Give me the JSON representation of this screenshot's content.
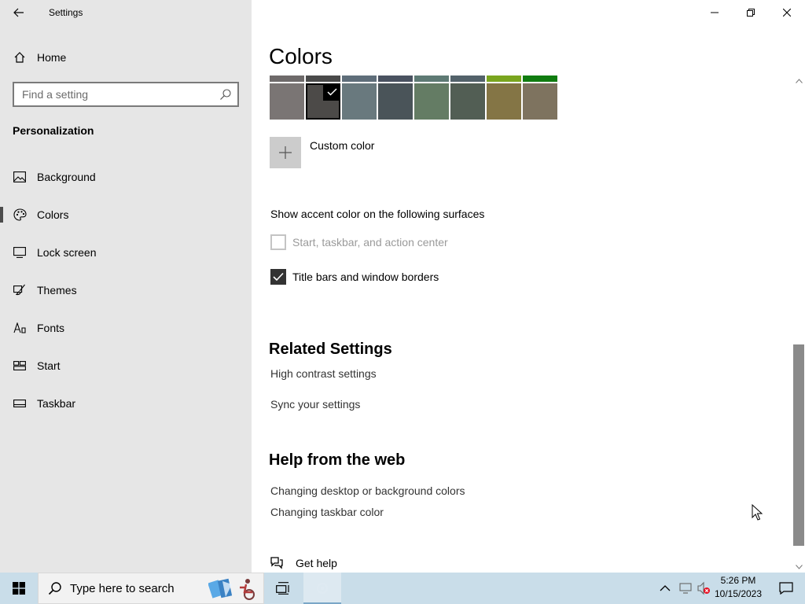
{
  "window": {
    "title": "Settings"
  },
  "sidebar": {
    "home_label": "Home",
    "search_placeholder": "Find a setting",
    "section_title": "Personalization",
    "items": [
      {
        "label": "Background",
        "icon": "image-icon",
        "active": false
      },
      {
        "label": "Colors",
        "icon": "palette-icon",
        "active": true
      },
      {
        "label": "Lock screen",
        "icon": "lock-screen-icon",
        "active": false
      },
      {
        "label": "Themes",
        "icon": "brush-icon",
        "active": false
      },
      {
        "label": "Fonts",
        "icon": "fonts-icon",
        "active": false
      },
      {
        "label": "Start",
        "icon": "start-icon",
        "active": false
      },
      {
        "label": "Taskbar",
        "icon": "taskbar-icon",
        "active": false
      }
    ]
  },
  "main": {
    "page_title": "Colors",
    "swatch_top_colors": [
      "#6e6a6a",
      "#4a4a4a",
      "#5f6e7a",
      "#4a5260",
      "#5e7a74",
      "#53626a",
      "#7aa51e",
      "#107c10"
    ],
    "swatch_colors": [
      "#7a7574",
      "#4c4a48",
      "#69797e",
      "#4a5459",
      "#647c64",
      "#525e54",
      "#847545",
      "#7e735f"
    ],
    "selected_swatch_index": 1,
    "custom_color_label": "Custom color",
    "surfaces_title": "Show accent color on the following surfaces",
    "checkbox_start": {
      "label": "Start, taskbar, and action center",
      "checked": false,
      "disabled": true
    },
    "checkbox_titlebars": {
      "label": "Title bars and window borders",
      "checked": true,
      "disabled": false
    },
    "related_title": "Related Settings",
    "related_links": [
      "High contrast settings",
      "Sync your settings"
    ],
    "help_title": "Help from the web",
    "help_links": [
      "Changing desktop or background colors",
      "Changing taskbar color"
    ],
    "get_help_label": "Get help"
  },
  "taskbar": {
    "search_placeholder": "Type here to search",
    "time": "5:26 PM",
    "date": "10/15/2023"
  },
  "colors": {
    "sidebar_bg": "#e6e6e6",
    "taskbar_bg": "#c9dde9"
  }
}
